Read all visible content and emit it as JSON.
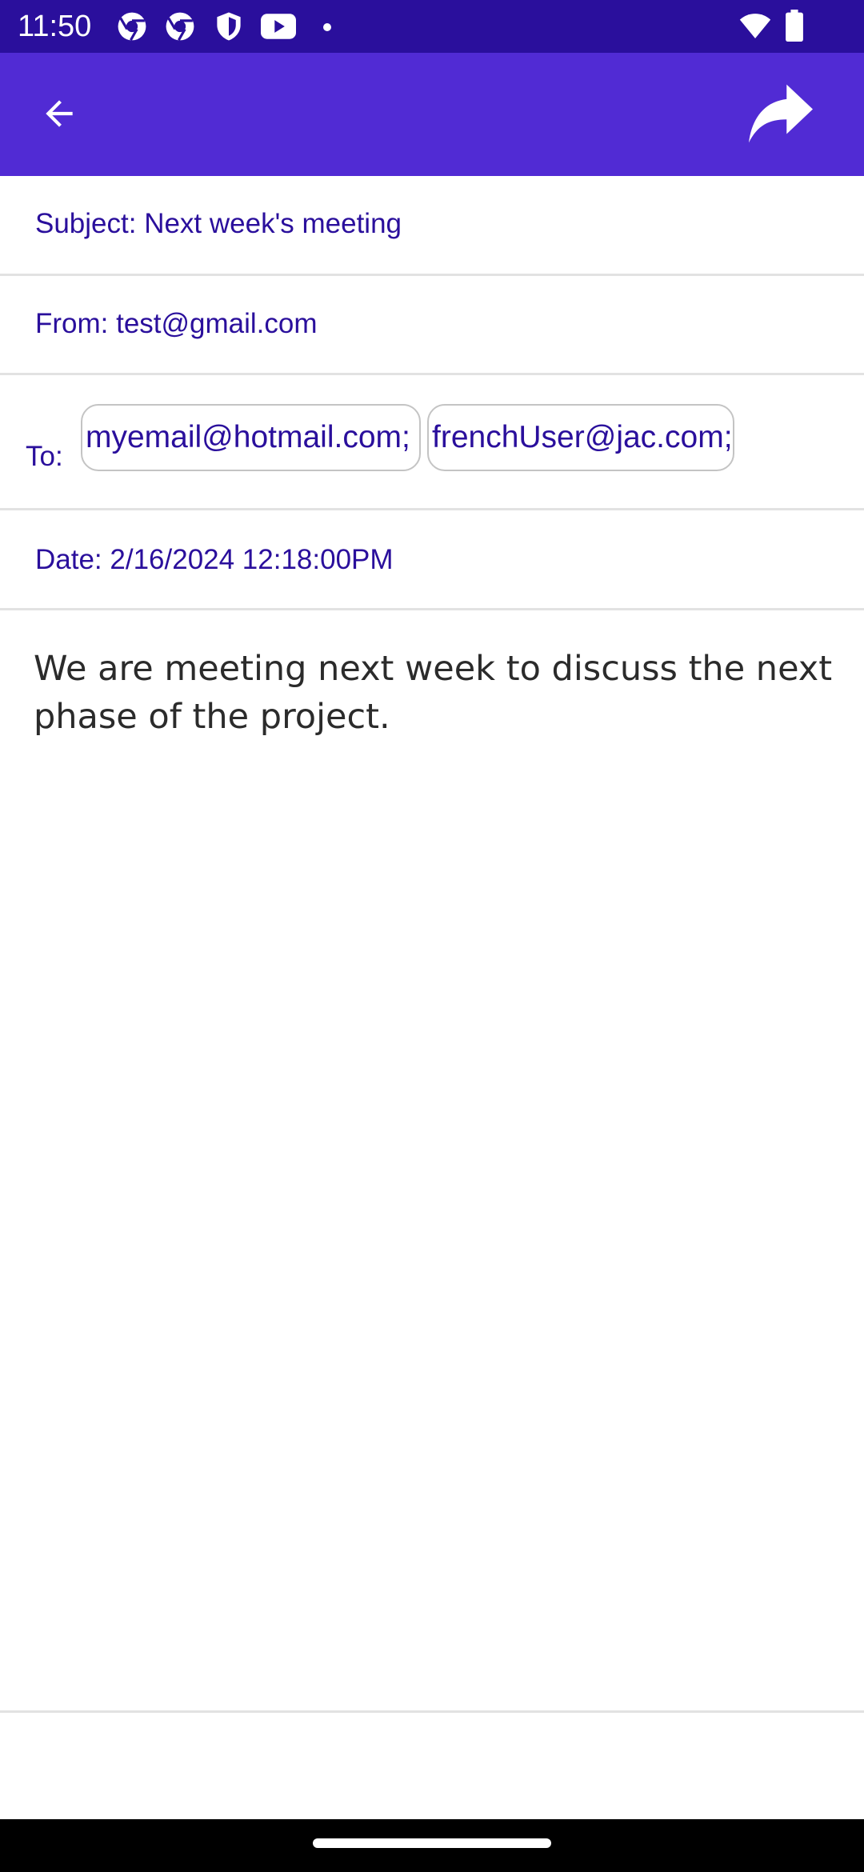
{
  "status_bar": {
    "time": "11:50",
    "icons": [
      "chrome-icon",
      "chrome-icon",
      "shield-icon",
      "youtube-icon",
      "notification-dot-icon",
      "wifi-icon",
      "battery-icon"
    ],
    "background": "#2a0f9c"
  },
  "app_bar": {
    "background": "#512bd4",
    "back_icon": "arrow-left-icon",
    "forward_icon": "forward-arrow-icon"
  },
  "email": {
    "subject": "Subject: Next week's meeting",
    "from": "From: test@gmail.com",
    "to_label": "To:",
    "to_recipients": [
      "myemail@hotmail.com;",
      "frenchUser@jac.com;"
    ],
    "date": "Date: 2/16/2024 12:18:00PM",
    "body": "We are meeting next week to discuss the next phase of the project."
  },
  "colors": {
    "accent": "#512bd4",
    "text_accent": "#2a0f9c",
    "divider": "#e2e2e2"
  }
}
